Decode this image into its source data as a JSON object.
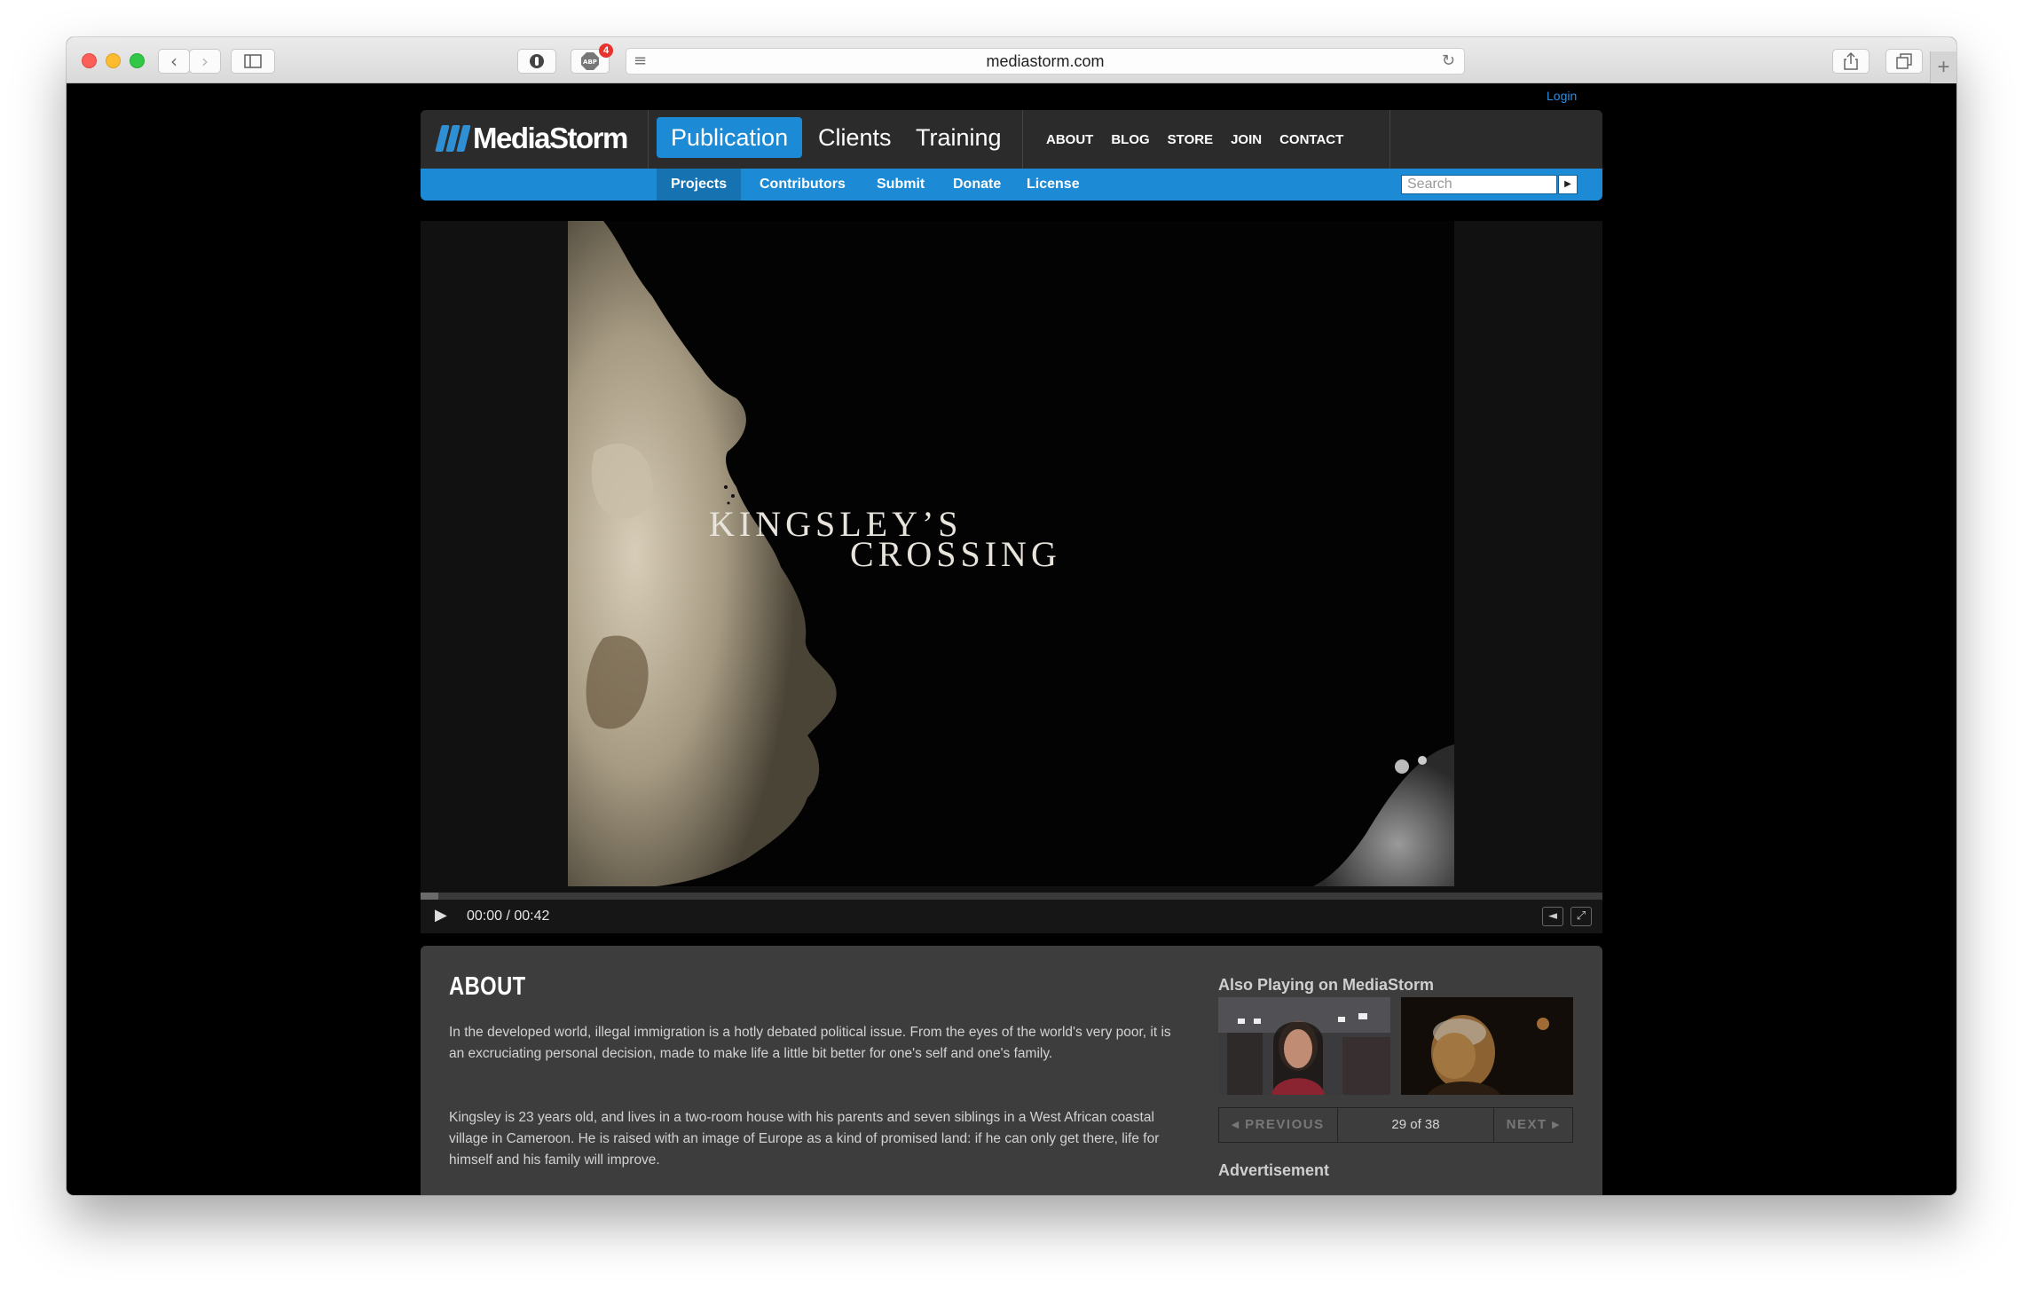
{
  "browser": {
    "url": "mediastorm.com",
    "adblock_badge": "4",
    "icons": [
      "back-icon",
      "forward-icon",
      "sidebar-icon",
      "privacy-extension-icon",
      "adblock-icon",
      "reader-icon",
      "reload-icon",
      "share-icon",
      "tabs-icon",
      "new-tab-icon"
    ]
  },
  "site": {
    "login": "Login",
    "logo": "MediaStorm",
    "main_nav": [
      "Publication",
      "Clients",
      "Training"
    ],
    "util_nav": [
      "ABOUT",
      "BLOG",
      "STORE",
      "JOIN",
      "CONTACT"
    ],
    "sub_nav": [
      "Projects",
      "Contributors",
      "Submit",
      "Donate",
      "License"
    ],
    "search_placeholder": "Search",
    "accent_color": "#1c8ad4"
  },
  "video": {
    "title_line1": "KINGSLEY’S",
    "title_line2": "CROSSING",
    "time": "00:00 / 00:42",
    "progress": 0.015
  },
  "about": {
    "heading": "ABOUT",
    "paragraphs": [
      "In the developed world, illegal immigration is a hotly debated political issue. From the eyes of the world's very poor, it is an excruciating personal decision, made to make life a little bit better for one's self and one's family.",
      "Kingsley is 23 years old, and lives in a two-room house with his parents and seven siblings in a West African coastal village in Cameroon. He is raised with an image of Europe as a kind of promised land: if he can only get there, life for himself and his family will improve."
    ]
  },
  "sidebar": {
    "also_playing": "Also Playing on MediaStorm",
    "prev": "PREVIOUS",
    "count": "29 of 38",
    "next": "NEXT",
    "advertisement": "Advertisement"
  }
}
